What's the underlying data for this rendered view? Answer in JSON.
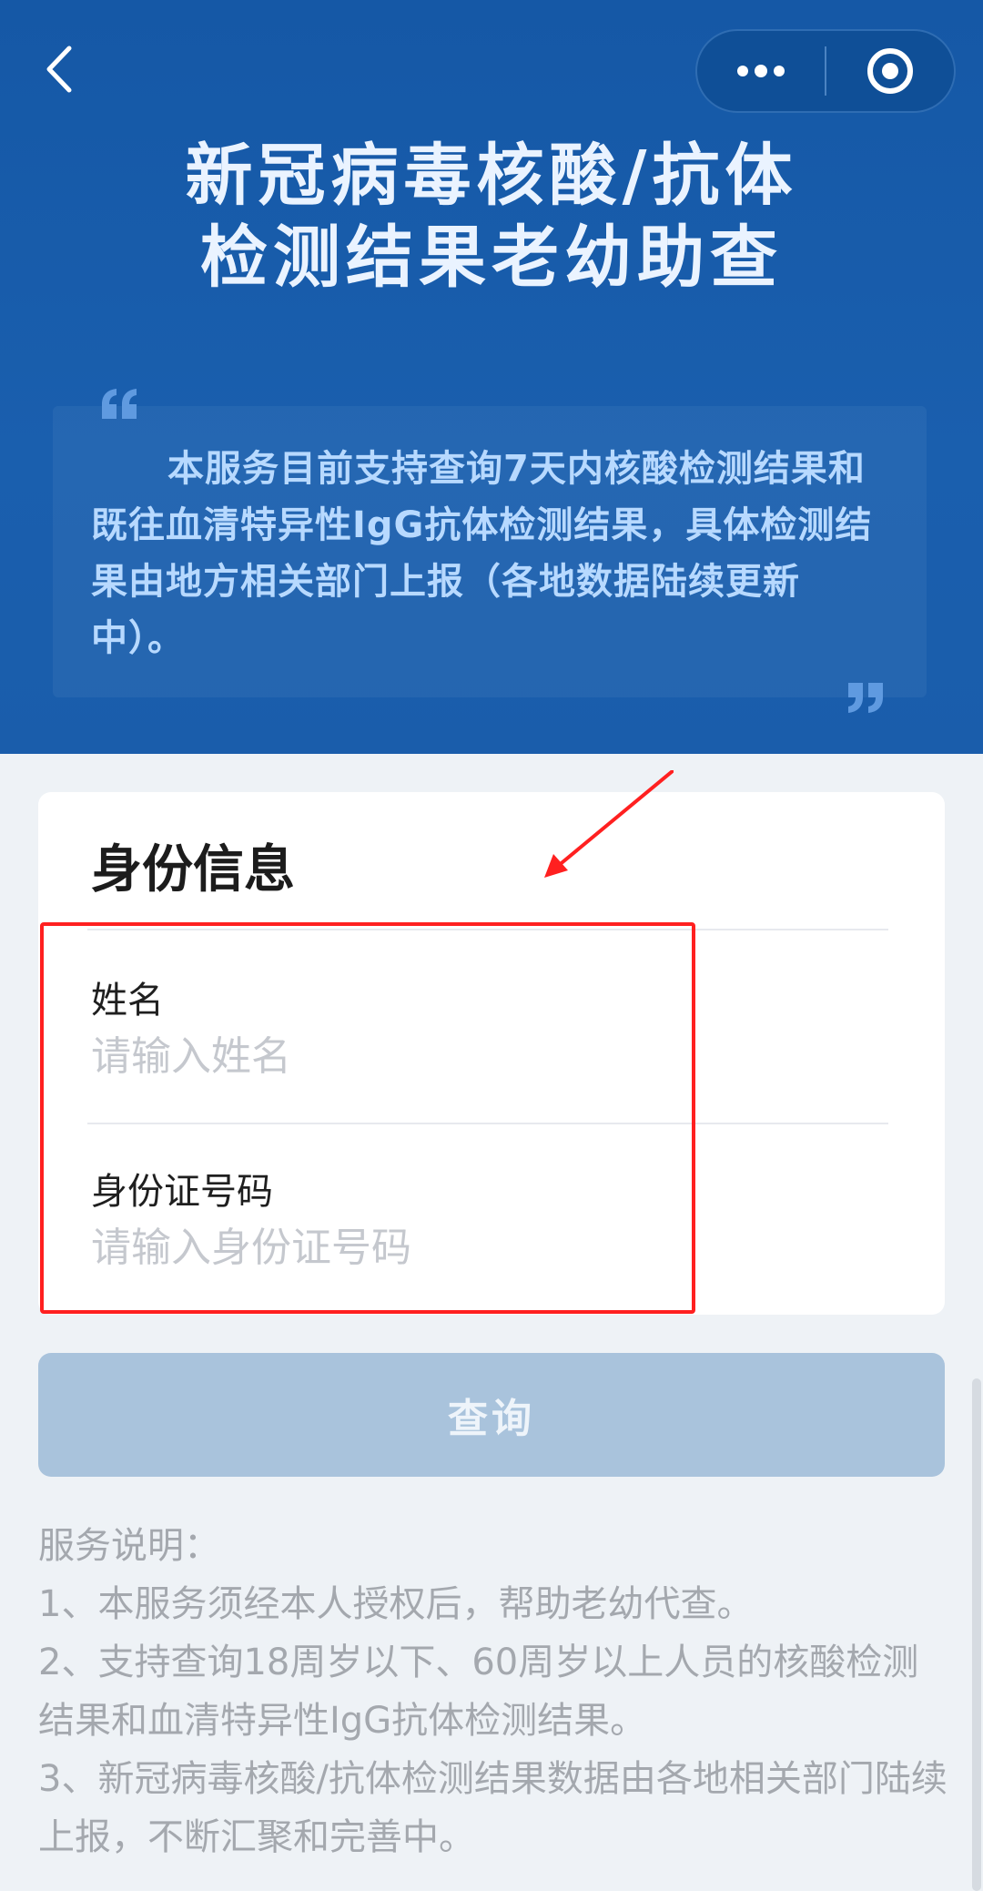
{
  "header": {
    "title_line1": "新冠病毒核酸/抗体",
    "title_line2": "检测结果老幼助查"
  },
  "intro": {
    "text": "本服务目前支持查询7天内核酸检测结果和既往血清特异性IgG抗体检测结果，具体检测结果由地方相关部门上报（各地数据陆续更新中）。"
  },
  "form": {
    "title": "身份信息",
    "name_label": "姓名",
    "name_placeholder": "请输入姓名",
    "name_value": "",
    "id_label": "身份证号码",
    "id_placeholder": "请输入身份证号码",
    "id_value": ""
  },
  "query_button": "查询",
  "service_notes": {
    "heading": "服务说明：",
    "items": [
      "1、本服务须经本人授权后，帮助老幼代查。",
      "2、支持查询18周岁以下、60周岁以上人员的核酸检测结果和血清特异性IgG抗体检测结果。",
      "3、新冠病毒核酸/抗体检测结果数据由各地相关部门陆续上报，不断汇聚和完善中。"
    ]
  },
  "icons": {
    "back": "chevron-left-icon",
    "more": "more-dots-icon",
    "close": "target-circle-icon",
    "quote_open": "quote-open-icon",
    "quote_close": "quote-close-icon"
  },
  "colors": {
    "header_bg": "#1a5dab",
    "button_disabled": "#a9c3dc",
    "annotation_red": "#ff2020"
  }
}
